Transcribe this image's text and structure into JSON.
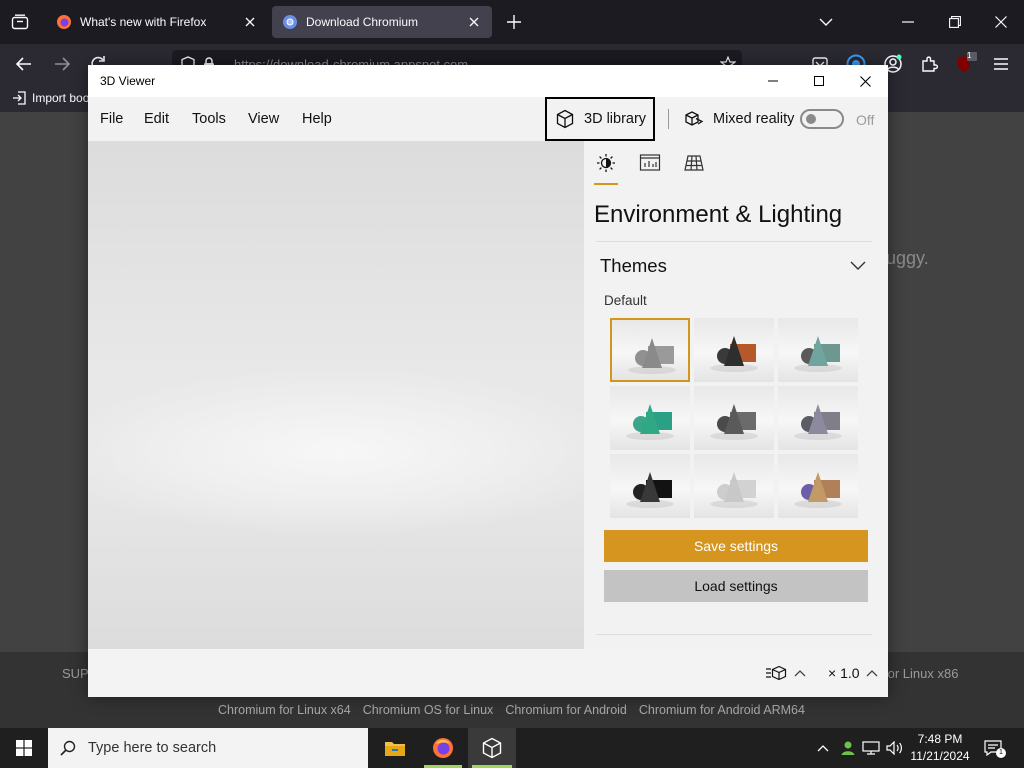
{
  "firefox": {
    "tabs": [
      {
        "title": "What's new with Firefox",
        "active": false
      },
      {
        "title": "Download Chromium",
        "active": true
      }
    ],
    "url": "https://download-chromium.appspot.com",
    "bookmarks": {
      "import_label": "Import boo"
    },
    "extension_badge": "1"
  },
  "page": {
    "side_text": "uggy.",
    "footer_left": "SUPP",
    "footer_right": "for Linux x86",
    "links": [
      "Chromium for Linux x64",
      "Chromium OS for Linux",
      "Chromium for Android",
      "Chromium for Android ARM64"
    ]
  },
  "viewer": {
    "app_title": "3D Viewer",
    "menu": [
      "File",
      "Edit",
      "Tools",
      "View",
      "Help"
    ],
    "library_label": "3D library",
    "mixed_reality_label": "Mixed reality",
    "mixed_reality_state": "Off",
    "panel": {
      "tabs": [
        "environment-lighting",
        "stats-shading",
        "grid-views"
      ],
      "title": "Environment & Lighting",
      "themes_header": "Themes",
      "default_label": "Default",
      "theme_colors": [
        {
          "cone": "#8a8a8a",
          "box": "#9a9a9a",
          "sphere": "#909090"
        },
        {
          "cone": "#2e2e2e",
          "box": "#b5582a",
          "sphere": "#3a3a3a"
        },
        {
          "cone": "#6fa59e",
          "box": "#6d9890",
          "sphere": "#5a5a5a"
        },
        {
          "cone": "#2fa886",
          "box": "#2ba084",
          "sphere": "#3aa58a"
        },
        {
          "cone": "#5a5a5a",
          "box": "#6b6b6b",
          "sphere": "#4a4a4a"
        },
        {
          "cone": "#8d8aa0",
          "box": "#7f7f8a",
          "sphere": "#5c5c66"
        },
        {
          "cone": "#383838",
          "box": "#121212",
          "sphere": "#222222"
        },
        {
          "cone": "#c8c8c8",
          "box": "#d2d2d2",
          "sphere": "#cdcdcd"
        },
        {
          "cone": "#c19a66",
          "box": "#b0805a",
          "sphere": "#6b5fa8"
        }
      ],
      "selected_theme": 0,
      "save_label": "Save settings",
      "load_label": "Load settings"
    },
    "status": {
      "zoom": "× 1.0"
    }
  },
  "taskbar": {
    "search_placeholder": "Type here to search",
    "time": "7:48 PM",
    "date": "11/21/2024"
  },
  "colors": {
    "accent": "#d5951f",
    "firefox_bg": "#1c1b22"
  }
}
